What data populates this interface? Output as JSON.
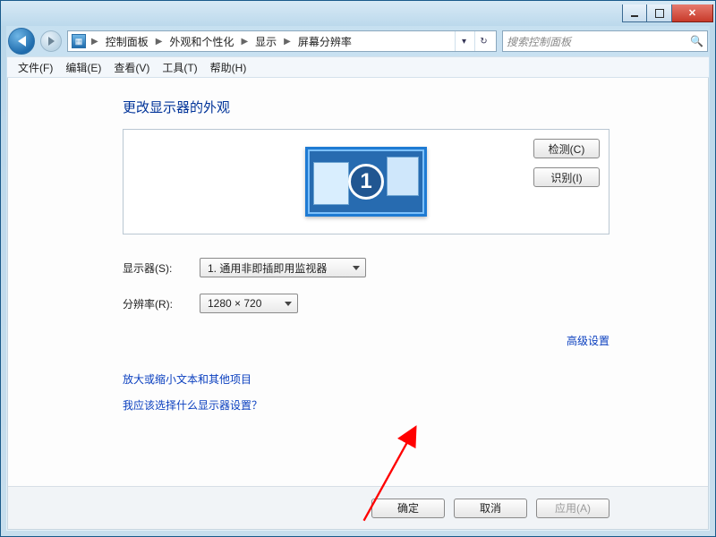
{
  "titlebar": {
    "title": ""
  },
  "breadcrumbs": {
    "root_sep": "▶",
    "items": [
      {
        "label": "控制面板"
      },
      {
        "label": "外观和个性化"
      },
      {
        "label": "显示"
      },
      {
        "label": "屏幕分辨率"
      }
    ]
  },
  "search": {
    "placeholder": "搜索控制面板"
  },
  "menubar": {
    "file": "文件(F)",
    "edit": "编辑(E)",
    "view": "查看(V)",
    "tools": "工具(T)",
    "help": "帮助(H)"
  },
  "page": {
    "title": "更改显示器的外观",
    "detect_btn": "检测(C)",
    "identify_btn": "识别(I)",
    "monitor_number": "1",
    "display_label": "显示器(S):",
    "display_value": "1. 通用非即插即用监视器",
    "resolution_label": "分辨率(R):",
    "resolution_value": "1280 × 720",
    "advanced_link": "高级设置",
    "link_text_size": "放大或缩小文本和其他项目",
    "link_which_settings": "我应该选择什么显示器设置？"
  },
  "footer": {
    "ok": "确定",
    "cancel": "取消",
    "apply": "应用(A)"
  }
}
